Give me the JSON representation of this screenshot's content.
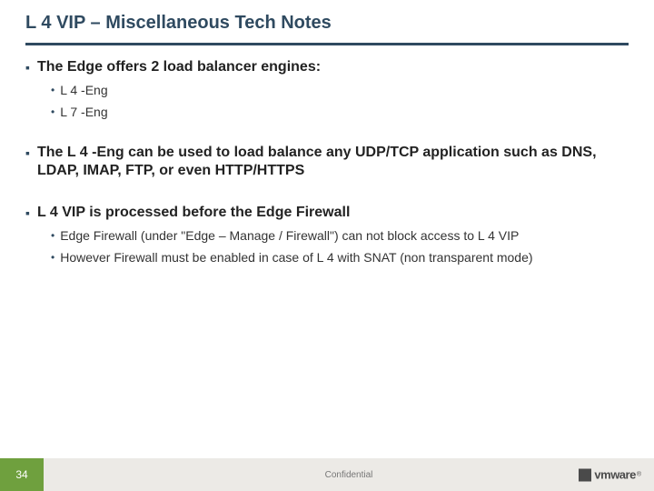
{
  "title": "L 4 VIP – Miscellaneous Tech Notes",
  "sections": [
    {
      "heading": "The Edge offers 2 load balancer engines:",
      "items": [
        "L 4 -Eng",
        "L 7 -Eng"
      ]
    },
    {
      "heading": "The L 4 -Eng can be used to load balance any UDP/TCP application such as DNS, LDAP, IMAP, FTP, or even HTTP/HTTPS",
      "items": []
    },
    {
      "heading": "L 4 VIP is processed before the Edge Firewall",
      "items": [
        "Edge Firewall (under \"Edge – Manage / Firewall\") can not block access to L 4 VIP",
        "However Firewall must be enabled in case of L 4 with SNAT (non transparent mode)"
      ]
    }
  ],
  "footer": {
    "page": "34",
    "confidential": "Confidential",
    "logo_text": "vmware",
    "logo_tm": "®"
  }
}
